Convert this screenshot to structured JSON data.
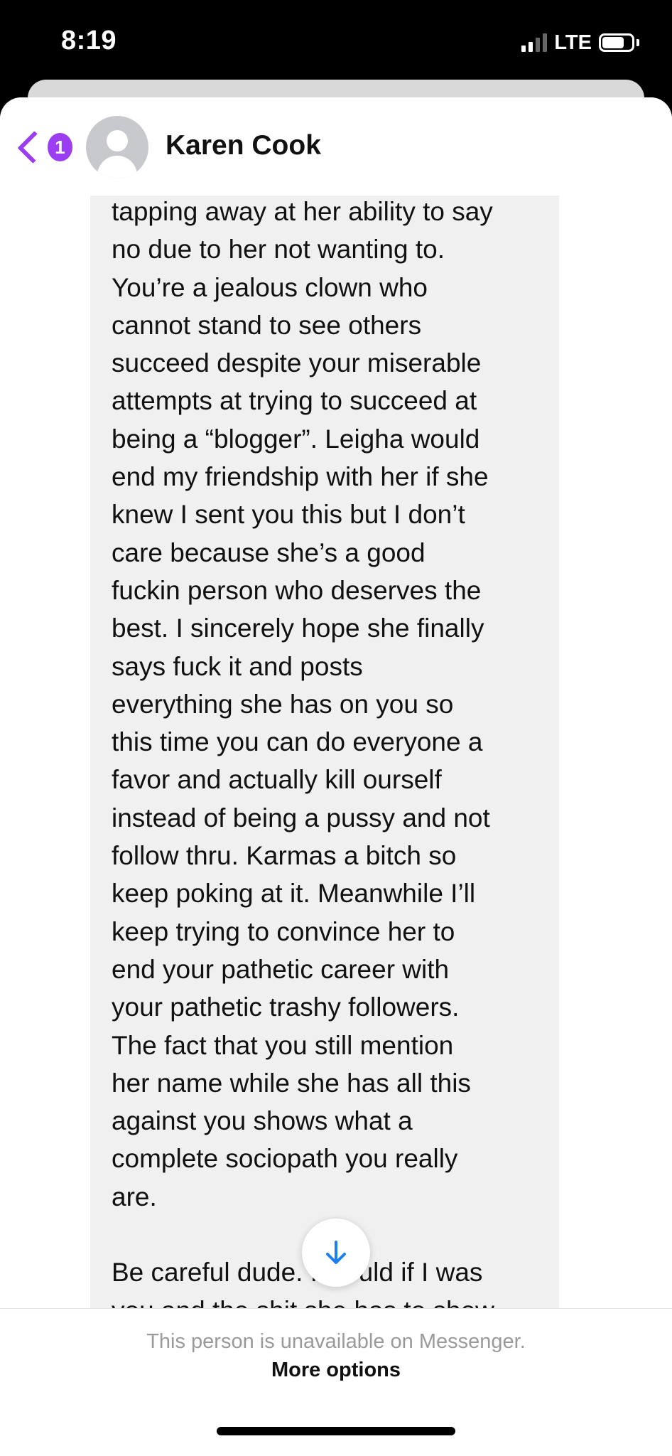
{
  "status_bar": {
    "time": "8:19",
    "network": "LTE",
    "signal_bars": 4,
    "signal_bars_active": 2,
    "battery_level": 0.75
  },
  "header": {
    "back_badge_count": "1",
    "contact_name": "Karen Cook"
  },
  "message": {
    "text": "tapping away at her ability to say\nno due to her not wanting to.\nYou’re a jealous clown who\ncannot stand to see others\nsucceed despite your miserable\nattempts at trying to succeed at\nbeing a “blogger”. Leigha would\nend my friendship with her if she\nknew I sent you this but I don’t\ncare because she’s a good\nfuckin person who deserves the\nbest. I sincerely hope she finally\nsays fuck it and posts\neverything she has on you so\nthis time you can do everyone a\nfavor and actually kill ourself\ninstead of being a pussy and not\nfollow thru. Karmas a bitch so\nkeep poking at it. Meanwhile I’ll\nkeep trying to convince her to\nend your pathetic career with\nyour pathetic trashy followers.\nThe fact that you still mention\nher name while she has all this\nagainst you shows what a\ncomplete sociopath you really\nare.\n\nBe careful dude. I would if I was\nyou and the shit she has to show"
  },
  "footer": {
    "unavailable_text": "This person is unavailable on Messenger.",
    "more_options_label": "More options"
  },
  "colors": {
    "accent": "#9b3df0",
    "scroll_arrow": "#1a7ff0",
    "bubble": "#f0f0f0"
  }
}
